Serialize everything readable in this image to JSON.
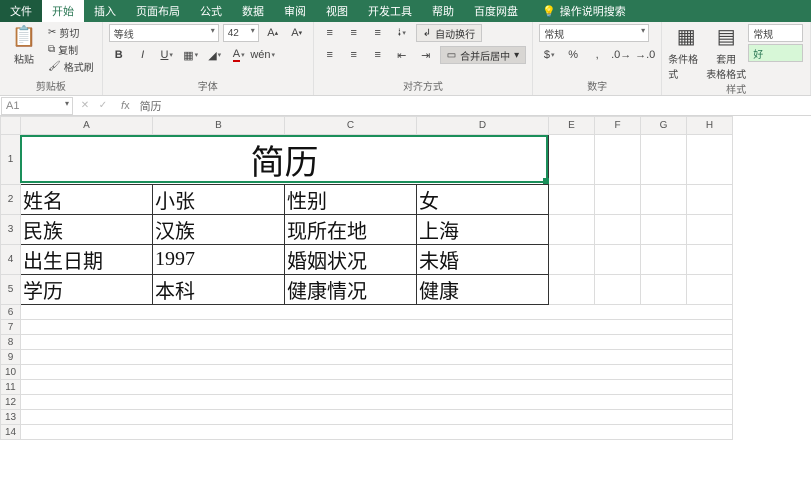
{
  "tabs": {
    "file": "文件",
    "home": "开始",
    "insert": "插入",
    "layout": "页面布局",
    "formula": "公式",
    "data": "数据",
    "review": "审阅",
    "view": "视图",
    "dev": "开发工具",
    "help": "帮助",
    "baidu": "百度网盘",
    "search": "操作说明搜索"
  },
  "ribbon": {
    "clipboard": {
      "cut": "剪切",
      "copy": "复制",
      "format_painter": "格式刷",
      "paste": "粘贴",
      "label": "剪贴板"
    },
    "font": {
      "name": "等线",
      "size": "42",
      "label": "字体"
    },
    "alignment": {
      "wrap": "自动换行",
      "merge": "合并后居中",
      "label": "对齐方式"
    },
    "number": {
      "format": "常规",
      "label": "数字"
    },
    "styles": {
      "cond": "条件格式",
      "table": "套用\n表格格式",
      "normal": "常规",
      "good": "好",
      "label": "样式"
    }
  },
  "formula_bar": {
    "name_box": "A1",
    "value": "简历"
  },
  "columns": [
    "A",
    "B",
    "C",
    "D",
    "E",
    "F",
    "G",
    "H"
  ],
  "rows": [
    "1",
    "2",
    "3",
    "4",
    "5",
    "6",
    "7",
    "8",
    "9",
    "10",
    "11",
    "12",
    "13",
    "14"
  ],
  "data": {
    "title": "简历",
    "r2": {
      "a": "姓名",
      "b": "小张",
      "c": "性别",
      "d": "女"
    },
    "r3": {
      "a": "民族",
      "b": "汉族",
      "c": "现所在地",
      "d": "上海"
    },
    "r4": {
      "a": "出生日期",
      "b": "1997",
      "c": "婚姻状况",
      "d": "未婚"
    },
    "r5": {
      "a": "学历",
      "b": "本科",
      "c": "健康情况",
      "d": "健康"
    }
  }
}
